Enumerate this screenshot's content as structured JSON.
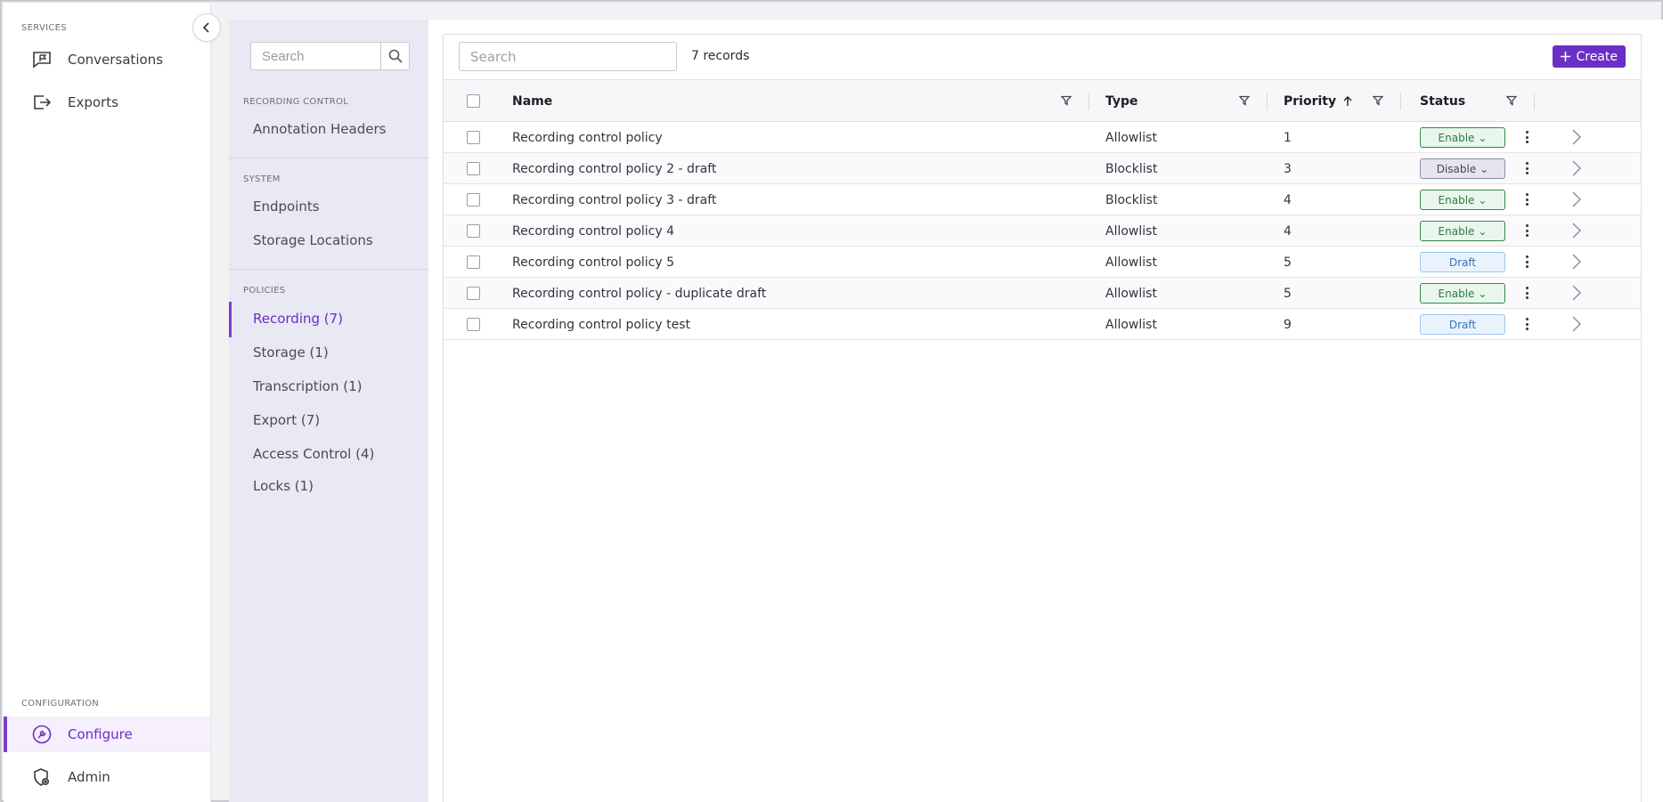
{
  "leftnav": {
    "services_label": "SERVICES",
    "config_label": "CONFIGURATION",
    "items": [
      {
        "label": "Conversations",
        "icon": "chat-flag-icon"
      },
      {
        "label": "Exports",
        "icon": "export-icon"
      },
      {
        "label": "Configure",
        "icon": "wrench-icon"
      },
      {
        "label": "Admin",
        "icon": "shield-gear-icon"
      }
    ]
  },
  "subnav": {
    "search_placeholder": "Search",
    "sections": [
      {
        "label": "RECORDING CONTROL",
        "items": [
          "Annotation Headers"
        ]
      },
      {
        "label": "SYSTEM",
        "items": [
          "Endpoints",
          "Storage Locations"
        ]
      },
      {
        "label": "POLICIES",
        "items": [
          "Recording (7)",
          "Storage (1)",
          "Transcription (1)",
          "Export (7)",
          "Access Control (4)",
          "Locks (1)"
        ]
      }
    ],
    "active": "Recording (7)"
  },
  "toolbar": {
    "search_placeholder": "Search",
    "records": "7 records",
    "create_label": "Create"
  },
  "table": {
    "columns": [
      "Name",
      "Type",
      "Priority",
      "Status"
    ],
    "sort": {
      "column": "Priority",
      "direction": "ascending"
    },
    "rows": [
      {
        "name": "Recording control policy",
        "type": "Allowlist",
        "priority": "1",
        "status": "Enable"
      },
      {
        "name": "Recording control policy 2 - draft",
        "type": "Blocklist",
        "priority": "3",
        "status": "Disable"
      },
      {
        "name": "Recording control policy 3 - draft",
        "type": "Blocklist",
        "priority": "4",
        "status": "Enable"
      },
      {
        "name": "Recording control policy 4",
        "type": "Allowlist",
        "priority": "4",
        "status": "Enable"
      },
      {
        "name": "Recording control policy 5",
        "type": "Allowlist",
        "priority": "5",
        "status": "Draft"
      },
      {
        "name": "Recording control policy - duplicate draft",
        "type": "Allowlist",
        "priority": "5",
        "status": "Enable"
      },
      {
        "name": "Recording control policy test",
        "type": "Allowlist",
        "priority": "9",
        "status": "Draft"
      }
    ]
  },
  "colors": {
    "accent": "#6b2fc7",
    "enable": "#2f8a4a",
    "disable": "#8c8ca6",
    "draft": "#3a73b5"
  }
}
